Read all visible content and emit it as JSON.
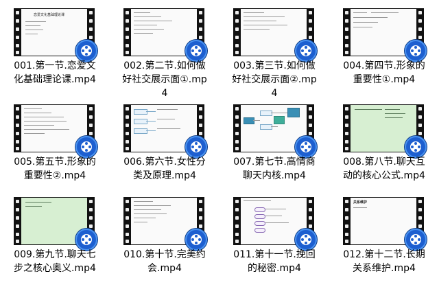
{
  "files": [
    {
      "name": "001.第一节.恋爱文化基础理论课.mp4",
      "preview": "white",
      "preview_title": "恋爱文化基础理论课"
    },
    {
      "name": "002.第二节.如何做好社交展示面①.mp4",
      "preview": "white",
      "preview_title": ""
    },
    {
      "name": "003.第三节.如何做好社交展示面②.mp4",
      "preview": "white",
      "preview_title": ""
    },
    {
      "name": "004.第四节.形象的重要性①.mp4",
      "preview": "white",
      "preview_title": ""
    },
    {
      "name": "005.第五节.形象的重要性②.mp4",
      "preview": "white",
      "preview_title": ""
    },
    {
      "name": "006.第六节.女性分类及原理.mp4",
      "preview": "mindmap",
      "preview_title": ""
    },
    {
      "name": "007.第七节.高情商聊天内核.mp4",
      "preview": "mindmap-dark",
      "preview_title": ""
    },
    {
      "name": "008.第八节.聊天互动的核心公式.mp4",
      "preview": "green",
      "preview_title": ""
    },
    {
      "name": "009.第九节.聊天七步之核心奥义.mp4",
      "preview": "green",
      "preview_title": ""
    },
    {
      "name": "010.第十节.完美约会.mp4",
      "preview": "white",
      "preview_title": ""
    },
    {
      "name": "011.第十一节.挽回的秘密.mp4",
      "preview": "mindmap-purple",
      "preview_title": ""
    },
    {
      "name": "012.第十二节.长期关系维护.mp4",
      "preview": "white",
      "preview_title": "关系维护"
    }
  ],
  "badge_icon": "video-player-icon",
  "colors": {
    "badge": "#1d5fd0",
    "film": "#111111",
    "green_slide": "#d7efd2"
  }
}
